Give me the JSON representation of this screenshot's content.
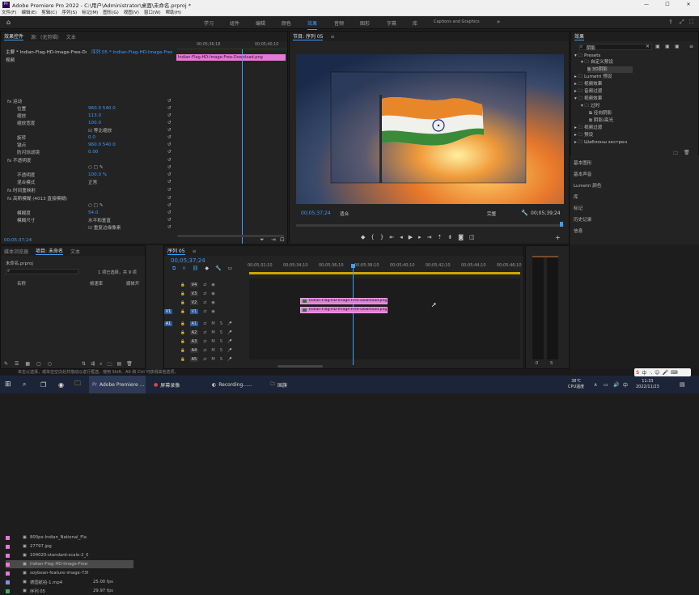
{
  "window": {
    "title": "Adobe Premiere Pro 2022 - C:\\用户\\Administrator\\桌面\\未命名.prproj *",
    "min": "—",
    "max": "☐",
    "close": "✕",
    "logo": "Pr"
  },
  "menu": [
    "文件(F)",
    "编辑(E)",
    "剪辑(C)",
    "序列(S)",
    "标记(M)",
    "图形(G)",
    "视图(V)",
    "窗口(W)",
    "帮助(H)"
  ],
  "workspaces": [
    "学习",
    "组件",
    "编辑",
    "颜色",
    "效果",
    "音频",
    "图形",
    "字幕",
    "库",
    "Captions and Graphics"
  ],
  "workspace_active": "效果",
  "effect_controls": {
    "tabs": [
      "效果控件",
      "源：(无剪辑)",
      "文本"
    ],
    "source": "主要 * Indian-Flag-HD-Image-Free-Downlo...",
    "seq": "序列 05 * Indian-Flag-HD-Image-Free-Do...",
    "clip_label": "Indian-Flag-HD-Image-Free-Download.png",
    "ruler": [
      "00;05;36;18",
      "00;05;40;10"
    ],
    "section": "视频",
    "rows": [
      {
        "label": "fx 运动",
        "val": ""
      },
      {
        "label": "位置",
        "val": "960.0    540.0"
      },
      {
        "label": "缩放",
        "val": "113.0"
      },
      {
        "label": "缩放宽度",
        "val": "100.0"
      },
      {
        "label": "",
        "val": "☑ 等比缩放"
      },
      {
        "label": "旋转",
        "val": "0.0"
      },
      {
        "label": "锚点",
        "val": "960.0    540.0"
      },
      {
        "label": "防闪烁滤镜",
        "val": "0.00"
      },
      {
        "label": "fx 不透明度",
        "val": ""
      },
      {
        "label": "",
        "val": "○ □ ✎"
      },
      {
        "label": "不透明度",
        "val": "100.0 %"
      },
      {
        "label": "混合模式",
        "val": "正常"
      },
      {
        "label": "fx 时间重映射",
        "val": ""
      },
      {
        "label": "fx 高斯模糊 (4013 直接模糊)",
        "val": ""
      },
      {
        "label": "",
        "val": "○ □ ✎"
      },
      {
        "label": "模糊度",
        "val": "54.0"
      },
      {
        "label": "模糊尺寸",
        "val": "水平和垂直"
      },
      {
        "label": "",
        "val": "☑ 重复边缘像素"
      }
    ],
    "timecode": "00;05;37;24"
  },
  "program": {
    "title": "节目: 序列 05",
    "timecode": "00;05;37;24",
    "fit": "适合",
    "quality": "完整",
    "duration": "00;05;39;24"
  },
  "effects": {
    "title": "效果",
    "search": "阴影",
    "tree": [
      "Presets",
      "自定义预设",
      "3D阴影",
      "Lumetri 预设",
      "视频效果",
      "音频过渡",
      "视频效果",
      "过时",
      "径向阴影",
      "阴影/高光",
      "视频过渡",
      "预设",
      "Шаблоны экстрен"
    ],
    "panels": [
      "基本图形",
      "基本声音",
      "Lumetri 颜色",
      "库",
      "标记",
      "历史记录",
      "信息"
    ]
  },
  "project": {
    "tabs": [
      "媒体浏览器",
      "项目: 未命名",
      "文本"
    ],
    "name": "未命名.prproj",
    "selected": "1 项已选择，共 9 项",
    "cols": [
      "名称",
      "帧速率",
      "媒体开"
    ],
    "items": [
      {
        "name": "800px-Indian_National_Fla",
        "rate": "",
        "color": "#e27ad8"
      },
      {
        "name": "27797.jpg",
        "rate": "",
        "color": "#e27ad8"
      },
      {
        "name": "104020-standard-scale-2_0",
        "rate": "",
        "color": "#e27ad8"
      },
      {
        "name": "Indian-Flag-HD-Image-Free-Download",
        "rate": "",
        "color": "#e27ad8"
      },
      {
        "name": "soybean-feature-image-736",
        "rate": "",
        "color": "#e27ad8"
      },
      {
        "name": "德国航拍-1.mp4",
        "rate": "25.00 fps",
        "color": "#8a8af0"
      },
      {
        "name": "序列 05",
        "rate": "29.97 fps",
        "color": "#3ab06a"
      }
    ]
  },
  "timeline": {
    "title": "序列 05",
    "timecode": "00;05;37;24",
    "ticks": [
      "00;05;32;10",
      "00;05;34;10",
      "00;05;36;10",
      "00;05;38;10",
      "00;05;40;10",
      "00;05;42;10",
      "00;05;44;10",
      "00;05;46;10"
    ],
    "tracks": [
      "V4",
      "V3",
      "V2",
      "V1",
      "A1",
      "A2",
      "A3",
      "A4",
      "A5"
    ],
    "clip": "Indian-Flag-HD-Image-Free-Download.png",
    "meter": [
      "0",
      "S"
    ]
  },
  "status": "单击以选择，或单击空白处并拖动以进行框选。使用 Shift、Alt 和 Ctrl 可获得其他选项。",
  "taskbar": {
    "apps": [
      "Adobe Premiere ...",
      "屏幕录像",
      "Recording......",
      "国旗"
    ],
    "temp": "38℃",
    "cpu": "CPU温度",
    "time": "11:33",
    "date": "2022/11/23",
    "lang": "中"
  },
  "colors": {
    "accent": "#3aa0ff",
    "clip": "#e27ad8"
  }
}
